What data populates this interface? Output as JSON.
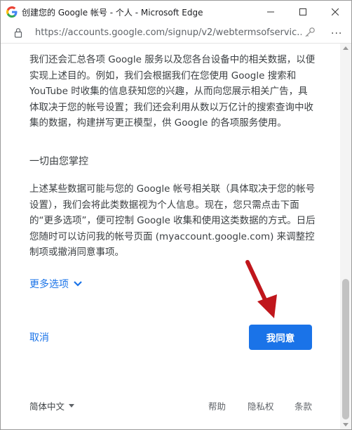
{
  "window": {
    "title": "创建您的 Google 帐号 - 个人 - Microsoft Edge",
    "url": "https://accounts.google.com/signup/v2/webtermsofservic..."
  },
  "content": {
    "paragraph1": "我们还会汇总各项 Google 服务以及您各台设备中的相关数据，以便实现上述目的。例如，我们会根据我们在您使用 Google 搜索和 YouTube 时收集的信息获知您的兴趣，从而向您展示相关广告，具体取决于您的帐号设置；我们还会利用从数以万亿计的搜索查询中收集的数据，构建拼写更正模型，供 Google 的各项服务使用。",
    "heading": "一切由您掌控",
    "paragraph2": "上述某些数据可能与您的 Google 帐号相关联（具体取决于您的帐号设置），我们会将此类数据视为个人信息。现在，您只需点击下面的“更多选项”，便可控制 Google 收集和使用这类数据的方式。日后您随时可以访问我的帐号页面 (myaccount.google.com) 来调整控制项或撤消同意事项。",
    "more_options": "更多选项",
    "cancel": "取消",
    "agree": "我同意"
  },
  "footer": {
    "language": "简体中文",
    "help": "帮助",
    "privacy": "隐私权",
    "terms": "条款"
  },
  "colors": {
    "accent": "#1a73e8",
    "arrow": "#c0161c"
  }
}
